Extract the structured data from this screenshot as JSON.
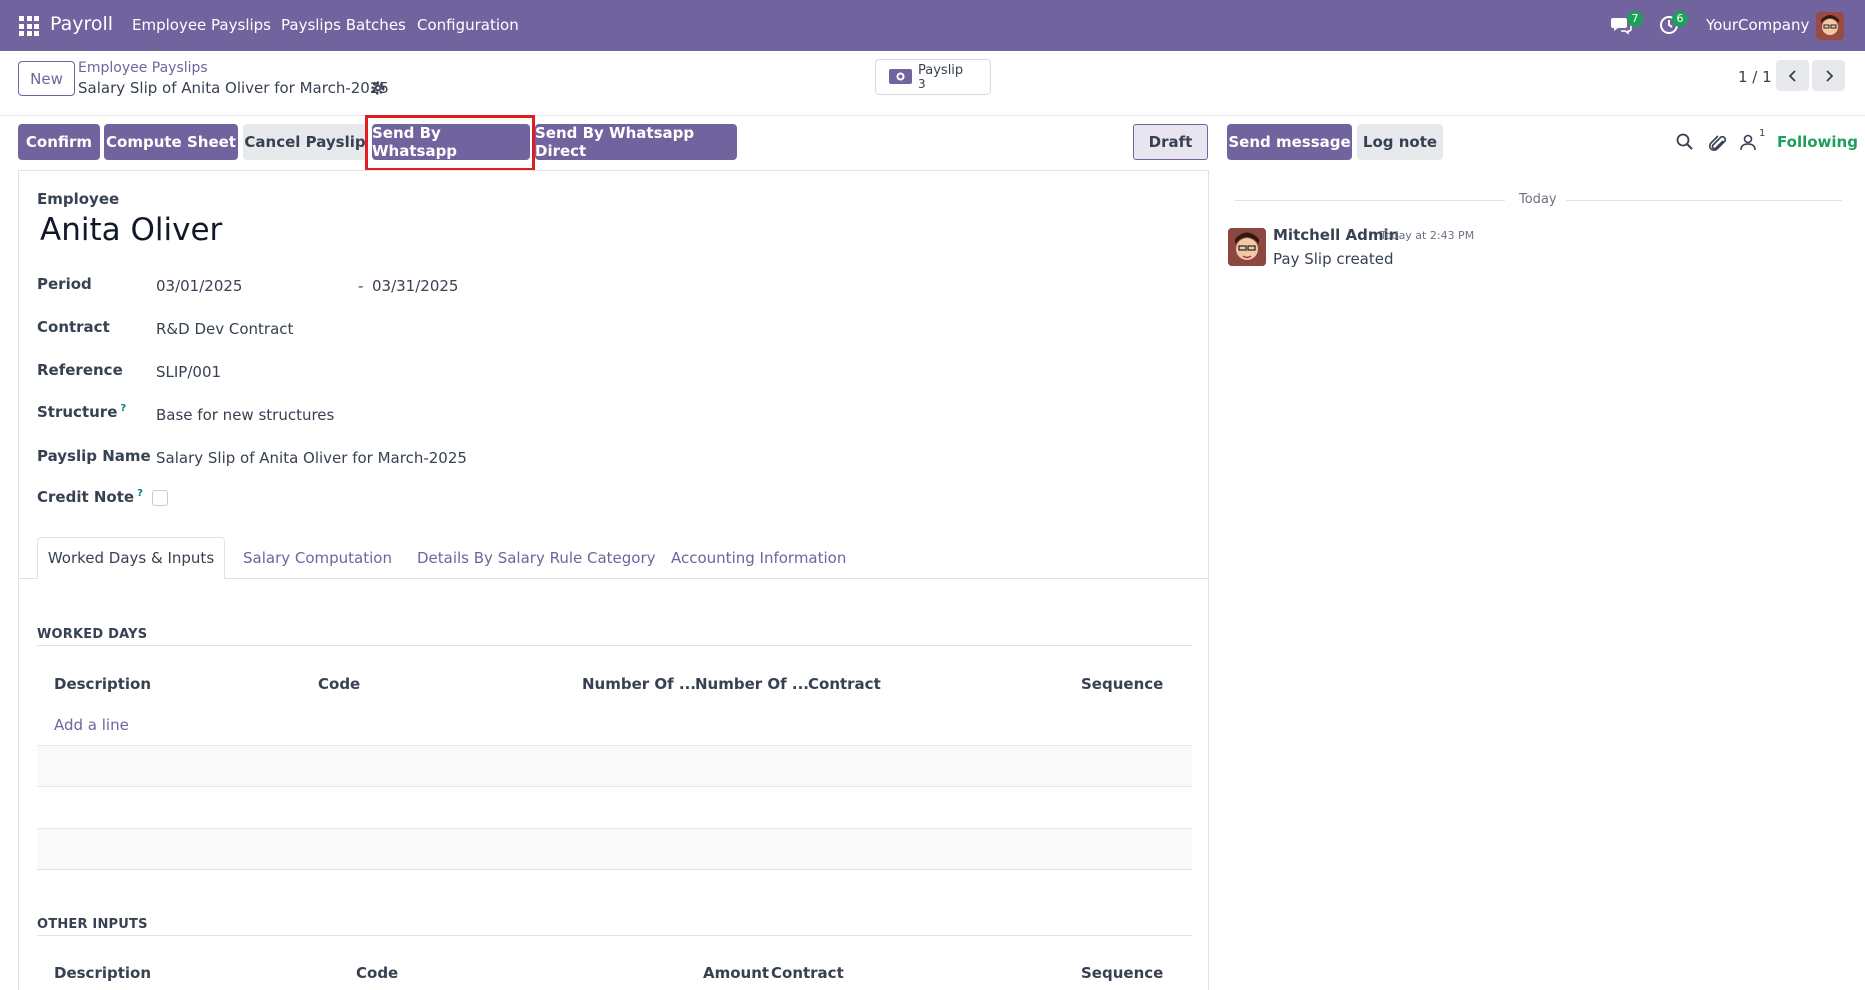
{
  "navbar": {
    "app_name": "Payroll",
    "menu": [
      "Employee Payslips",
      "Payslips Batches",
      "Configuration"
    ],
    "messages_badge": "7",
    "activities_badge": "6",
    "company": "YourCompany"
  },
  "control": {
    "new_label": "New",
    "breadcrumb_parent": "Employee Payslips",
    "breadcrumb_current": "Salary Slip of Anita Oliver for March-2025",
    "smart_button": {
      "label": "Payslip",
      "count": "3"
    },
    "pager": "1 / 1"
  },
  "actions": {
    "confirm": "Confirm",
    "compute_sheet": "Compute Sheet",
    "cancel_payslip": "Cancel Payslip",
    "send_whatsapp": "Send By Whatsapp",
    "send_whatsapp_direct": "Send By Whatsapp Direct",
    "status": "Draft"
  },
  "form": {
    "employee_label": "Employee",
    "employee_name": "Anita Oliver",
    "period_label": "Period",
    "period_from": "03/01/2025",
    "period_sep": "-",
    "period_to": "03/31/2025",
    "contract_label": "Contract",
    "contract_value": "R&D Dev Contract",
    "reference_label": "Reference",
    "reference_value": "SLIP/001",
    "structure_label": "Structure",
    "structure_value": "Base for new structures",
    "payslip_name_label": "Payslip Name",
    "payslip_name_value": "Salary Slip of Anita Oliver for March-2025",
    "credit_note_label": "Credit Note",
    "help_mark": "?"
  },
  "tabs": [
    "Worked Days & Inputs",
    "Salary Computation",
    "Details By Salary Rule Category",
    "Accounting Information"
  ],
  "worked_days": {
    "title": "WORKED DAYS",
    "columns": [
      "Description",
      "Code",
      "Number Of ...",
      "Number Of ...",
      "Contract",
      "Sequence"
    ],
    "add_line": "Add a line"
  },
  "other_inputs": {
    "title": "OTHER INPUTS",
    "columns": [
      "Description",
      "Code",
      "Amount",
      "Contract",
      "Sequence"
    ]
  },
  "chatter": {
    "send_message": "Send message",
    "log_note": "Log note",
    "followers_count": "1",
    "following": "Following",
    "date_separator": "Today",
    "message": {
      "author": "Mitchell Admin",
      "time": "Today at 2:43 PM",
      "body": "Pay Slip created"
    }
  },
  "colors": {
    "brand": "#71639e",
    "success": "#1e9f5a",
    "highlight": "#e11d22"
  }
}
